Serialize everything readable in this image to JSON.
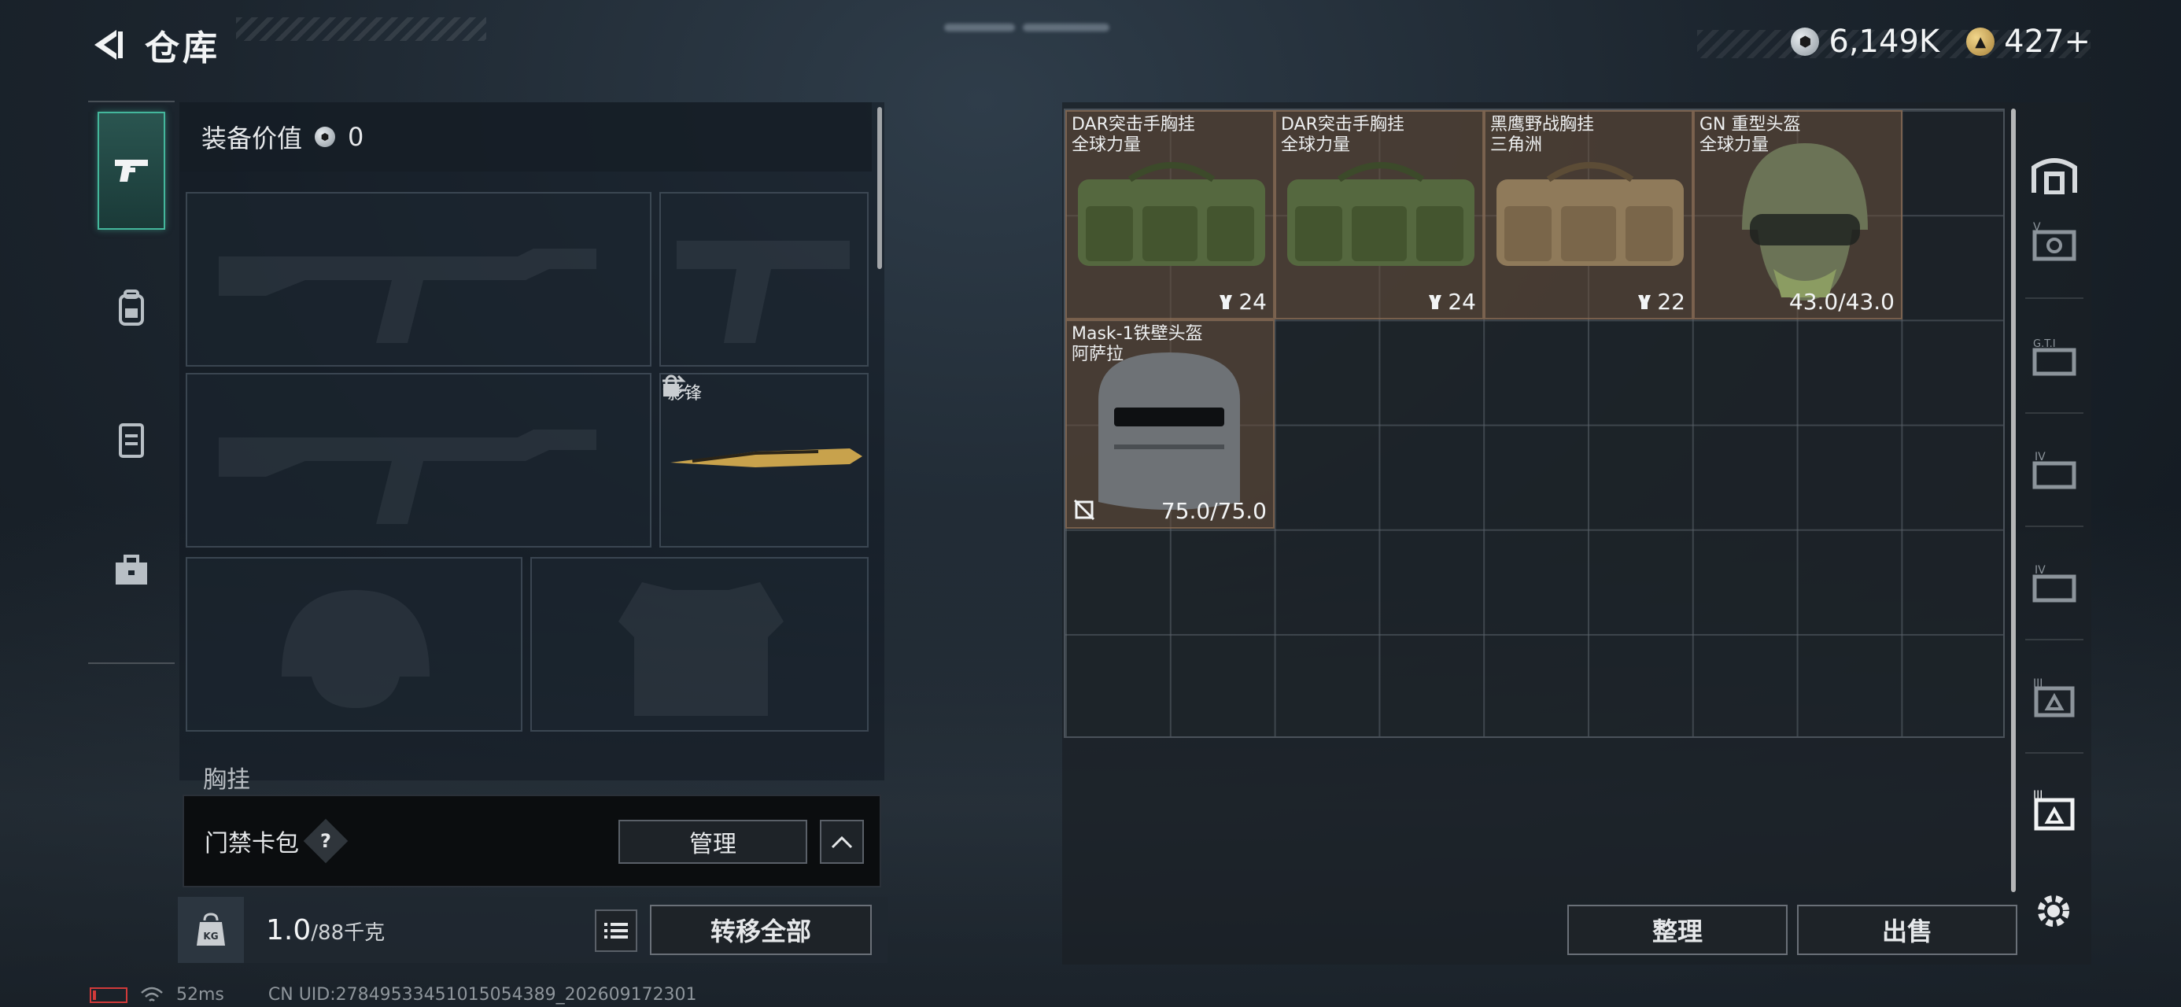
{
  "header": {
    "title": "仓库",
    "currency_silver": "6,149K",
    "currency_gold": "427+"
  },
  "rail": {
    "items": [
      {
        "icon": "pistol-icon",
        "active": true
      },
      {
        "icon": "backpack-icon",
        "active": false
      },
      {
        "icon": "chest-rig-icon",
        "active": false
      },
      {
        "icon": "toolbox-icon",
        "active": false
      }
    ]
  },
  "loadout": {
    "equip_value_label": "装备价值",
    "equip_value": "0",
    "melee_slot_label": "影锋",
    "chest_label": "胸挂"
  },
  "cardbar": {
    "label": "门禁卡包",
    "help": "?",
    "manage_label": "管理"
  },
  "weightbar": {
    "weight_value": "1.0",
    "weight_max": "/88千克",
    "kg_icon_text": "KG",
    "transfer_all_label": "转移全部"
  },
  "status": {
    "ping": "52ms",
    "uid": "CN UID:27849533451015054389_202609172301"
  },
  "stash": {
    "items": [
      {
        "name": "DAR突击手胸挂",
        "sub": "全球力量",
        "count": "24",
        "kind": "rig"
      },
      {
        "name": "DAR突击手胸挂",
        "sub": "全球力量",
        "count": "24",
        "kind": "rig"
      },
      {
        "name": "黑鹰野战胸挂",
        "sub": "三角洲",
        "count": "22",
        "kind": "rig"
      },
      {
        "name": "GN 重型头盔",
        "sub": "全球力量",
        "count": "43.0/43.0",
        "kind": "helmet"
      },
      {
        "name": "Mask-1铁壁头盔",
        "sub": "阿萨拉",
        "count": "75.0/75.0",
        "kind": "mask"
      }
    ],
    "sort_label": "整理",
    "sell_label": "出售"
  },
  "container_rail": {
    "items": [
      {
        "icon": "safe-box-icon",
        "text": ""
      },
      {
        "icon": "container-v-icon",
        "text": "V"
      },
      {
        "icon": "container-gti-icon",
        "text": "G.T.I"
      },
      {
        "icon": "container-iv-icon",
        "text": "IV"
      },
      {
        "icon": "container-iv-b-icon",
        "text": "IV"
      },
      {
        "icon": "container-iii-icon",
        "text": "III"
      },
      {
        "icon": "container-iii-active-icon",
        "text": "III"
      }
    ]
  },
  "colors": {
    "accent_teal": "#44b79c",
    "item_bg": "#69503c",
    "battery_red": "#d13a3a"
  }
}
